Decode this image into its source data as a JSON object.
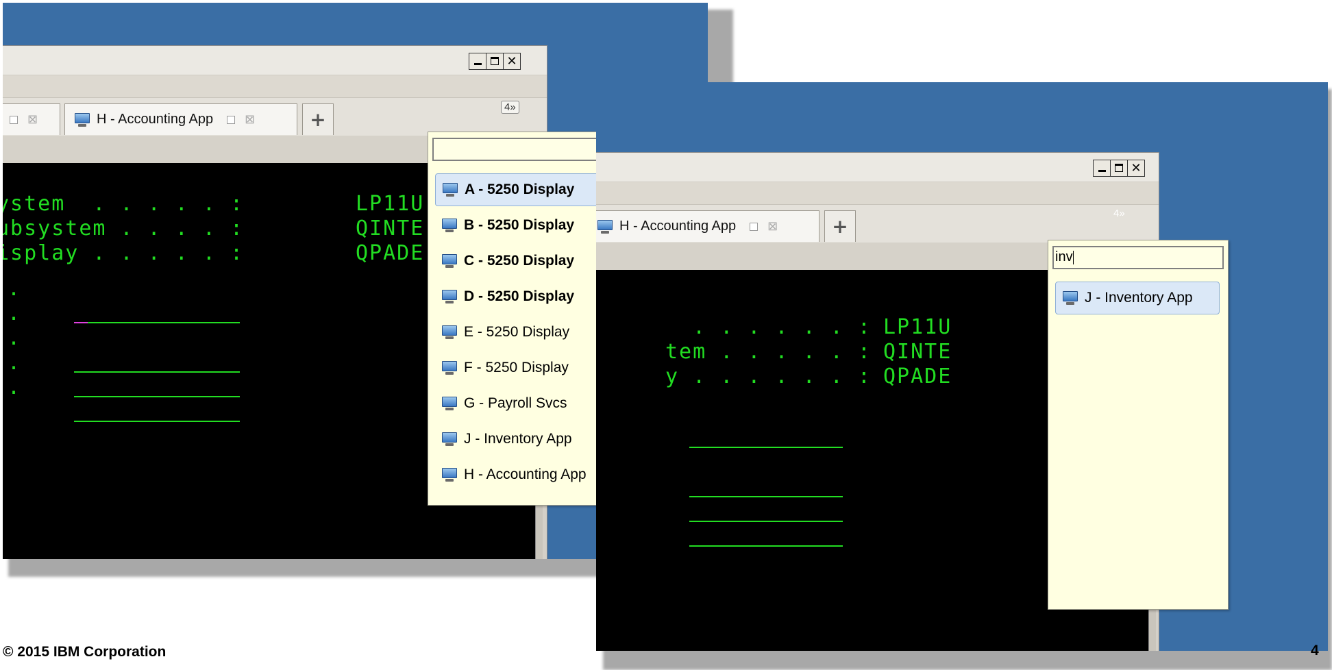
{
  "screenshot_left": {
    "tabs": [
      {
        "label": "H - Accounting App"
      }
    ],
    "new_tab_icon": "plus-icon",
    "tab_overflow": "4»",
    "window_buttons": [
      "minimize",
      "maximize",
      "close"
    ],
    "terminal": {
      "rows": [
        {
          "label": "ystem  . . . . . :",
          "value": "LP11U"
        },
        {
          "label": "ubsystem . . . . :",
          "value": "QINTE"
        },
        {
          "label": "isplay . . . . . :",
          "value": "QPADE"
        }
      ]
    },
    "session_switcher": {
      "filter_value": "",
      "items": [
        {
          "label": "A - 5250 Display",
          "bold": true,
          "selected": true
        },
        {
          "label": "B - 5250 Display",
          "bold": true
        },
        {
          "label": "C - 5250 Display",
          "bold": true
        },
        {
          "label": "D - 5250 Display",
          "bold": true
        },
        {
          "label": "E - 5250 Display"
        },
        {
          "label": "F - 5250 Display"
        },
        {
          "label": "G - Payroll Svcs"
        },
        {
          "label": "J - Inventory App"
        },
        {
          "label": "H - Accounting App"
        }
      ]
    }
  },
  "screenshot_right": {
    "tabs": [
      {
        "label": "H - Accounting App"
      }
    ],
    "tab_overflow": "4»",
    "terminal": {
      "rows": [
        {
          "label": "  . . . . . . :",
          "value": "LP11U"
        },
        {
          "label": "tem . . . . . :",
          "value": "QINTE"
        },
        {
          "label": "y . . . . . . :",
          "value": "QPADE"
        }
      ]
    },
    "session_switcher": {
      "filter_value": "inv",
      "items": [
        {
          "label": "J - Inventory App",
          "selected": true
        }
      ]
    }
  },
  "footer": {
    "copyright": "© 2015 IBM Corporation",
    "page_number": "4"
  },
  "colors": {
    "desktop": "#3a6ea5",
    "terminal_bg": "#000000",
    "terminal_text": "#22dd22",
    "popup_bg": "#ffffe1",
    "selection": "#dbe8f7"
  }
}
